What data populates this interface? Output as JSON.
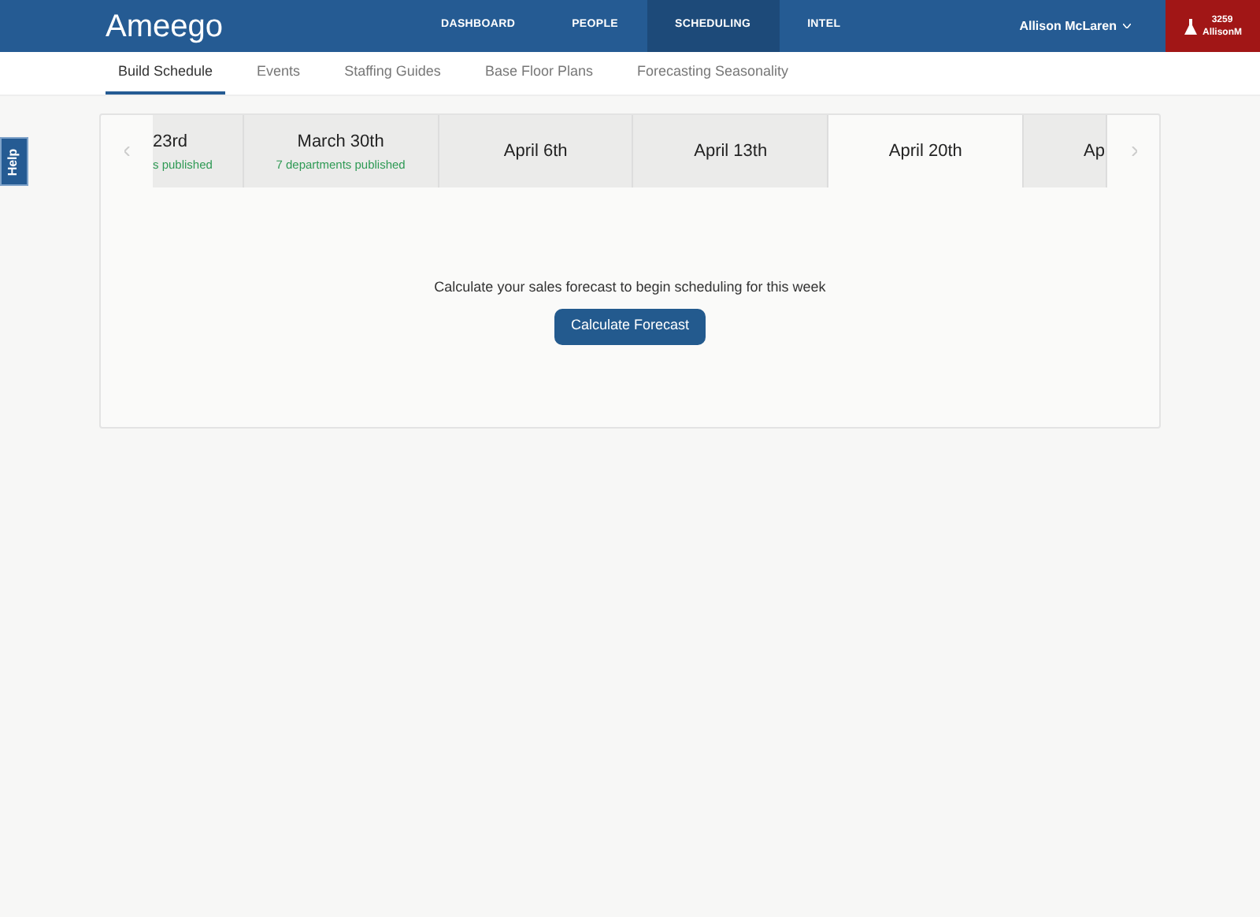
{
  "header": {
    "logo": "Ameego",
    "nav": [
      {
        "label": "DASHBOARD",
        "selected": false
      },
      {
        "label": "PEOPLE",
        "selected": false
      },
      {
        "label": "SCHEDULING",
        "selected": true
      },
      {
        "label": "INTEL",
        "selected": false
      }
    ],
    "user": "Allison McLaren",
    "account": {
      "number": "3259",
      "name": "AllisonM"
    }
  },
  "tabs": [
    {
      "label": "Build Schedule",
      "selected": true
    },
    {
      "label": "Events",
      "selected": false
    },
    {
      "label": "Staffing Guides",
      "selected": false
    },
    {
      "label": "Base Floor Plans",
      "selected": false
    },
    {
      "label": "Forecasting Seasonality",
      "selected": false
    }
  ],
  "help": "Help",
  "weeks": [
    {
      "kind": "partial-start",
      "label": "23rd",
      "subtitle": "s published",
      "selected": false
    },
    {
      "kind": "full",
      "label": "March 30th",
      "subtitle": "7 departments published",
      "selected": false
    },
    {
      "kind": "full",
      "label": "April 6th",
      "selected": false
    },
    {
      "kind": "full",
      "label": "April 13th",
      "selected": false
    },
    {
      "kind": "full",
      "label": "April 20th",
      "selected": true
    },
    {
      "kind": "partial-end",
      "label": "Ap",
      "selected": false
    }
  ],
  "message": "Calculate your sales forecast to begin scheduling for this week",
  "action": "Calculate Forecast"
}
